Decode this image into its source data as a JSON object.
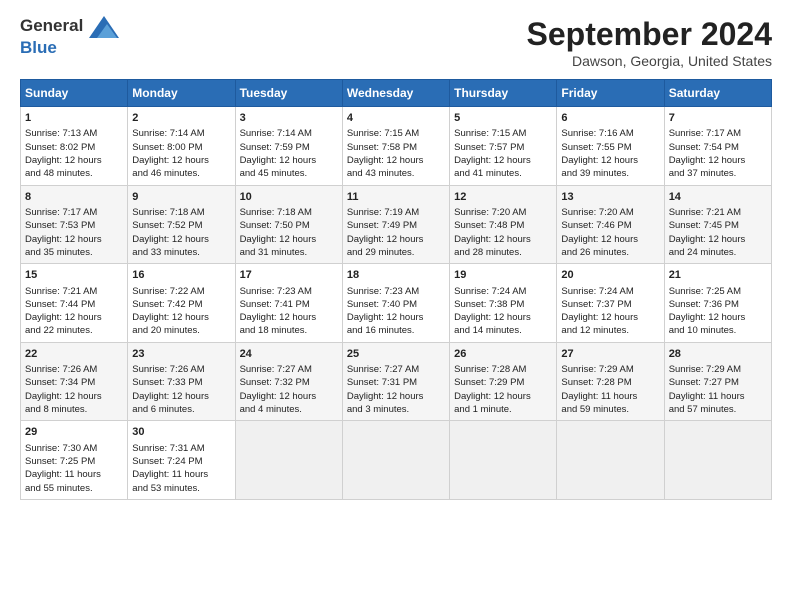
{
  "logo": {
    "line1": "General",
    "line2": "Blue"
  },
  "title": "September 2024",
  "subtitle": "Dawson, Georgia, United States",
  "days_header": [
    "Sunday",
    "Monday",
    "Tuesday",
    "Wednesday",
    "Thursday",
    "Friday",
    "Saturday"
  ],
  "weeks": [
    [
      {
        "num": "1",
        "sunrise": "7:13 AM",
        "sunset": "8:02 PM",
        "daylight": "12 hours and 48 minutes."
      },
      {
        "num": "2",
        "sunrise": "7:14 AM",
        "sunset": "8:00 PM",
        "daylight": "12 hours and 46 minutes."
      },
      {
        "num": "3",
        "sunrise": "7:14 AM",
        "sunset": "7:59 PM",
        "daylight": "12 hours and 45 minutes."
      },
      {
        "num": "4",
        "sunrise": "7:15 AM",
        "sunset": "7:58 PM",
        "daylight": "12 hours and 43 minutes."
      },
      {
        "num": "5",
        "sunrise": "7:15 AM",
        "sunset": "7:57 PM",
        "daylight": "12 hours and 41 minutes."
      },
      {
        "num": "6",
        "sunrise": "7:16 AM",
        "sunset": "7:55 PM",
        "daylight": "12 hours and 39 minutes."
      },
      {
        "num": "7",
        "sunrise": "7:17 AM",
        "sunset": "7:54 PM",
        "daylight": "12 hours and 37 minutes."
      }
    ],
    [
      {
        "num": "8",
        "sunrise": "7:17 AM",
        "sunset": "7:53 PM",
        "daylight": "12 hours and 35 minutes."
      },
      {
        "num": "9",
        "sunrise": "7:18 AM",
        "sunset": "7:52 PM",
        "daylight": "12 hours and 33 minutes."
      },
      {
        "num": "10",
        "sunrise": "7:18 AM",
        "sunset": "7:50 PM",
        "daylight": "12 hours and 31 minutes."
      },
      {
        "num": "11",
        "sunrise": "7:19 AM",
        "sunset": "7:49 PM",
        "daylight": "12 hours and 29 minutes."
      },
      {
        "num": "12",
        "sunrise": "7:20 AM",
        "sunset": "7:48 PM",
        "daylight": "12 hours and 28 minutes."
      },
      {
        "num": "13",
        "sunrise": "7:20 AM",
        "sunset": "7:46 PM",
        "daylight": "12 hours and 26 minutes."
      },
      {
        "num": "14",
        "sunrise": "7:21 AM",
        "sunset": "7:45 PM",
        "daylight": "12 hours and 24 minutes."
      }
    ],
    [
      {
        "num": "15",
        "sunrise": "7:21 AM",
        "sunset": "7:44 PM",
        "daylight": "12 hours and 22 minutes."
      },
      {
        "num": "16",
        "sunrise": "7:22 AM",
        "sunset": "7:42 PM",
        "daylight": "12 hours and 20 minutes."
      },
      {
        "num": "17",
        "sunrise": "7:23 AM",
        "sunset": "7:41 PM",
        "daylight": "12 hours and 18 minutes."
      },
      {
        "num": "18",
        "sunrise": "7:23 AM",
        "sunset": "7:40 PM",
        "daylight": "12 hours and 16 minutes."
      },
      {
        "num": "19",
        "sunrise": "7:24 AM",
        "sunset": "7:38 PM",
        "daylight": "12 hours and 14 minutes."
      },
      {
        "num": "20",
        "sunrise": "7:24 AM",
        "sunset": "7:37 PM",
        "daylight": "12 hours and 12 minutes."
      },
      {
        "num": "21",
        "sunrise": "7:25 AM",
        "sunset": "7:36 PM",
        "daylight": "12 hours and 10 minutes."
      }
    ],
    [
      {
        "num": "22",
        "sunrise": "7:26 AM",
        "sunset": "7:34 PM",
        "daylight": "12 hours and 8 minutes."
      },
      {
        "num": "23",
        "sunrise": "7:26 AM",
        "sunset": "7:33 PM",
        "daylight": "12 hours and 6 minutes."
      },
      {
        "num": "24",
        "sunrise": "7:27 AM",
        "sunset": "7:32 PM",
        "daylight": "12 hours and 4 minutes."
      },
      {
        "num": "25",
        "sunrise": "7:27 AM",
        "sunset": "7:31 PM",
        "daylight": "12 hours and 3 minutes."
      },
      {
        "num": "26",
        "sunrise": "7:28 AM",
        "sunset": "7:29 PM",
        "daylight": "12 hours and 1 minute."
      },
      {
        "num": "27",
        "sunrise": "7:29 AM",
        "sunset": "7:28 PM",
        "daylight": "11 hours and 59 minutes."
      },
      {
        "num": "28",
        "sunrise": "7:29 AM",
        "sunset": "7:27 PM",
        "daylight": "11 hours and 57 minutes."
      }
    ],
    [
      {
        "num": "29",
        "sunrise": "7:30 AM",
        "sunset": "7:25 PM",
        "daylight": "11 hours and 55 minutes."
      },
      {
        "num": "30",
        "sunrise": "7:31 AM",
        "sunset": "7:24 PM",
        "daylight": "11 hours and 53 minutes."
      },
      null,
      null,
      null,
      null,
      null
    ]
  ]
}
